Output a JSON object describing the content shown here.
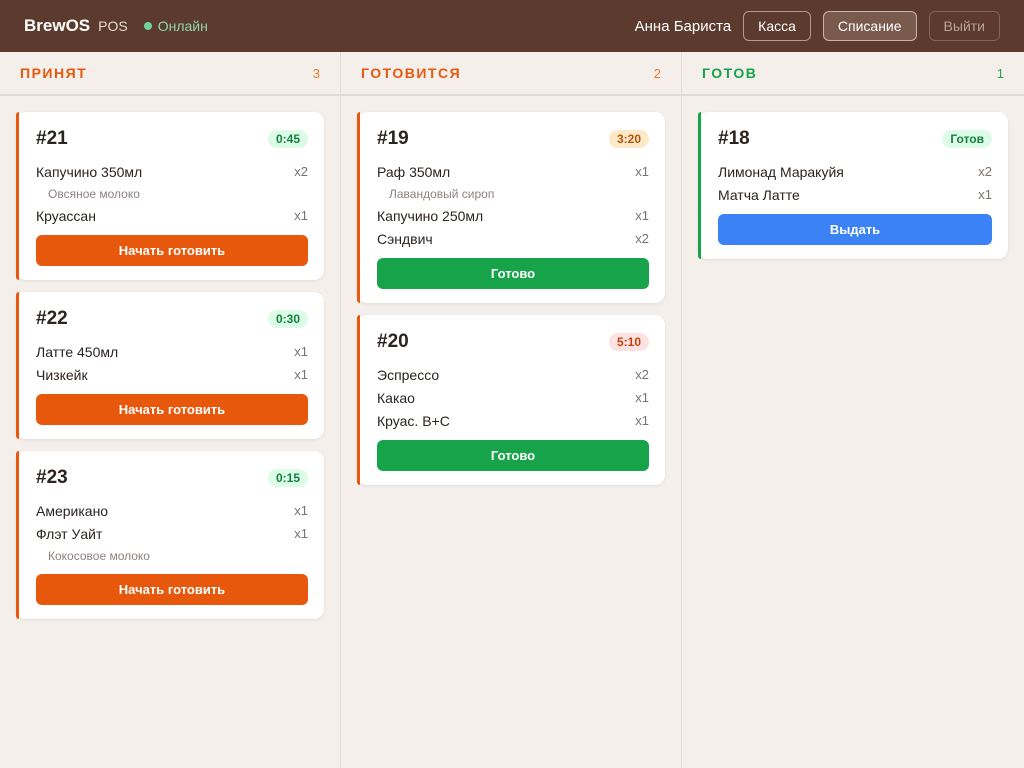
{
  "header": {
    "brand": "BrewOS",
    "brand_sub": "POS",
    "status": "Онлайн",
    "user": "Анна Бариста",
    "buttons": [
      "Касса",
      "Списание",
      "Выйти"
    ]
  },
  "colors": {
    "header_bg": "#5c3b2e",
    "orange": "#e8580c",
    "green": "#17a34a",
    "blue": "#3b82f6"
  },
  "columns": [
    {
      "title": "ПРИНЯТ",
      "count": "3",
      "color": "#e8580c",
      "count_color": "#e8792b",
      "action_label": "Начать готовить",
      "action_color": "#e8580c",
      "orders": [
        {
          "num": "#21",
          "timer": "0:45",
          "timer_bg": "#dcfce7",
          "timer_color": "#15803d",
          "items": [
            {
              "name": "Капучино 350мл",
              "qty": "x2",
              "mod": "Овсяное молоко"
            },
            {
              "name": "Круассан",
              "qty": "x1"
            }
          ]
        },
        {
          "num": "#22",
          "timer": "0:30",
          "timer_bg": "#dcfce7",
          "timer_color": "#15803d",
          "items": [
            {
              "name": "Латте 450мл",
              "qty": "x1"
            },
            {
              "name": "Чизкейк",
              "qty": "x1"
            }
          ]
        },
        {
          "num": "#23",
          "timer": "0:15",
          "timer_bg": "#dcfce7",
          "timer_color": "#15803d",
          "items": [
            {
              "name": "Американо",
              "qty": "x1"
            },
            {
              "name": "Флэт Уайт",
              "qty": "x1",
              "mod": "Кокосовое молоко"
            }
          ]
        }
      ]
    },
    {
      "title": "ГОТОВИТСЯ",
      "count": "2",
      "color": "#e8580c",
      "count_color": "#e8792b",
      "action_label": "Готово",
      "action_color": "#17a34a",
      "orders": [
        {
          "num": "#19",
          "timer": "3:20",
          "timer_bg": "#fde9c8",
          "timer_color": "#b45309",
          "items": [
            {
              "name": "Раф 350мл",
              "qty": "x1",
              "mod": "Лавандовый сироп"
            },
            {
              "name": "Капучино 250мл",
              "qty": "x1"
            },
            {
              "name": "Сэндвич",
              "qty": "x2"
            }
          ]
        },
        {
          "num": "#20",
          "timer": "5:10",
          "timer_bg": "#fde2e2",
          "timer_color": "#c2410c",
          "items": [
            {
              "name": "Эспрессо",
              "qty": "x2"
            },
            {
              "name": "Какао",
              "qty": "x1"
            },
            {
              "name": "Круас. В+С",
              "qty": "x1"
            }
          ]
        }
      ]
    },
    {
      "title": "ГОТОВ",
      "count": "1",
      "color": "#17a34a",
      "count_color": "#22a352",
      "action_label": "Выдать",
      "action_color": "#3b82f6",
      "orders": [
        {
          "num": "#18",
          "timer": "Готов",
          "timer_bg": "#dcfce7",
          "timer_color": "#15803d",
          "items": [
            {
              "name": "Лимонад Маракуйя",
              "qty": "x2"
            },
            {
              "name": "Матча Латте",
              "qty": "x1"
            }
          ]
        }
      ]
    }
  ]
}
